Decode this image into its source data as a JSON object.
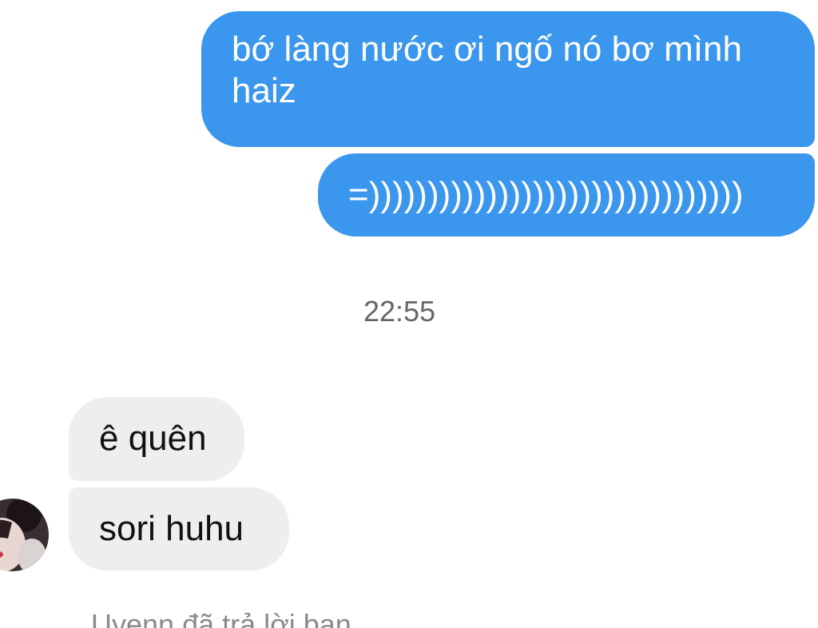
{
  "conversation": {
    "messages": [
      {
        "direction": "outgoing",
        "text": "bớ làng nước ơi ngố nó bơ mình haiz"
      },
      {
        "direction": "outgoing",
        "text": "=))))))))))))))))))))))))))))))))"
      },
      {
        "direction": "incoming",
        "text": "ê quên"
      },
      {
        "direction": "incoming",
        "text": "sori huhu"
      }
    ],
    "timestamp": "22:55",
    "reply_status": "Uyenn đã trả lời bạn"
  },
  "colors": {
    "outgoing_bubble": "#3b96ee",
    "incoming_bubble": "#eeeeee",
    "timestamp_text": "#666666"
  },
  "icons": {
    "contact_avatar": "avatar-photo"
  }
}
